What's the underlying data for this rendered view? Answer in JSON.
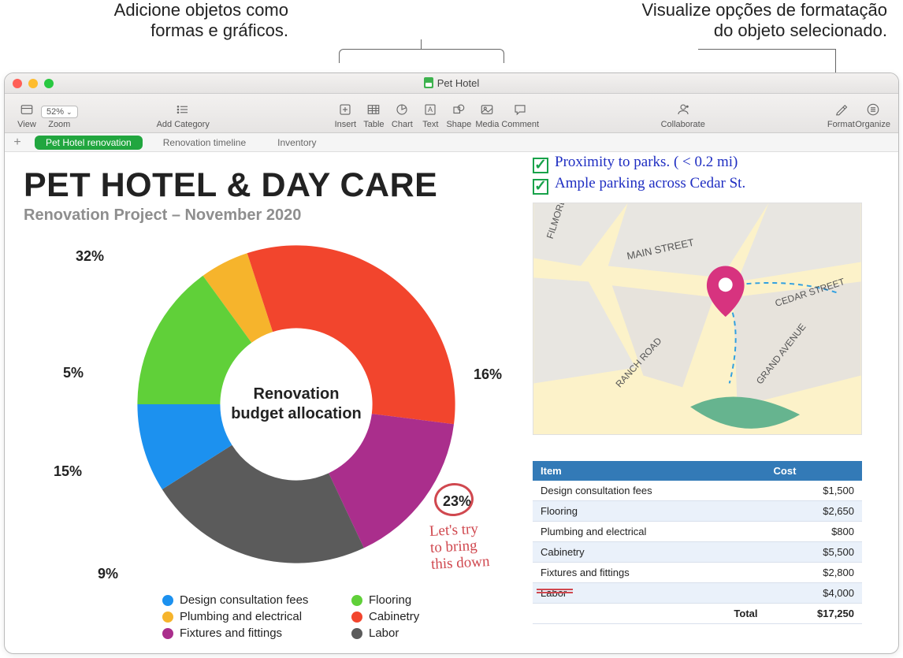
{
  "callouts": {
    "left_line1": "Adicione objetos como",
    "left_line2": "formas e gráficos.",
    "right_line1": "Visualize opções de formatação",
    "right_line2": "do objeto selecionado."
  },
  "window": {
    "title": "Pet Hotel"
  },
  "toolbar": {
    "view": "View",
    "zoom_value": "52%",
    "zoom_label": "Zoom",
    "add_category": "Add Category",
    "insert": "Insert",
    "table": "Table",
    "chart": "Chart",
    "text": "Text",
    "shape": "Shape",
    "media": "Media",
    "comment": "Comment",
    "collaborate": "Collaborate",
    "format": "Format",
    "organize": "Organize"
  },
  "sheets": {
    "t1": "Pet Hotel renovation",
    "t2": "Renovation timeline",
    "t3": "Inventory"
  },
  "doc": {
    "title": "PET HOTEL & DAY CARE",
    "subtitle": "Renovation Project – November 2020",
    "donut_center": "Renovation budget allocation",
    "labels": {
      "l32": "32%",
      "l16": "16%",
      "l23": "23%",
      "l9": "9%",
      "l15": "15%",
      "l5": "5%"
    },
    "note1": "Proximity to parks. ( < 0.2 mi)",
    "note2": "Ample parking across  Cedar St.",
    "map": {
      "main": "MAIN STREET",
      "filmore": "FILMORE ST.",
      "cedar": "CEDAR STREET",
      "ranch": "RANCH ROAD",
      "grand": "GRAND AVENUE"
    },
    "handnote_l1": "Let's try",
    "handnote_l2": "to bring",
    "handnote_l3": "this down",
    "th_item": "Item",
    "th_cost": "Cost",
    "rows": [
      {
        "item": "Design consultation fees",
        "cost": "$1,500"
      },
      {
        "item": "Flooring",
        "cost": "$2,650"
      },
      {
        "item": "Plumbing and electrical",
        "cost": "$800"
      },
      {
        "item": "Cabinetry",
        "cost": "$5,500"
      },
      {
        "item": "Fixtures and fittings",
        "cost": "$2,800"
      },
      {
        "item": "Labor",
        "cost": "$4,000"
      }
    ],
    "total_label": "Total",
    "total_value": "$17,250"
  },
  "chart_data": {
    "type": "pie",
    "title": "Renovation budget allocation",
    "series": [
      {
        "name": "Design consultation fees",
        "value": 9,
        "color": "#1c91ef"
      },
      {
        "name": "Flooring",
        "value": 15,
        "color": "#60d039"
      },
      {
        "name": "Plumbing and electrical",
        "value": 5,
        "color": "#f6b42c"
      },
      {
        "name": "Cabinetry",
        "value": 32,
        "color": "#f2452d"
      },
      {
        "name": "Fixtures and fittings",
        "value": 16,
        "color": "#aa2e8c"
      },
      {
        "name": "Labor",
        "value": 23,
        "color": "#5b5b5b"
      }
    ]
  }
}
